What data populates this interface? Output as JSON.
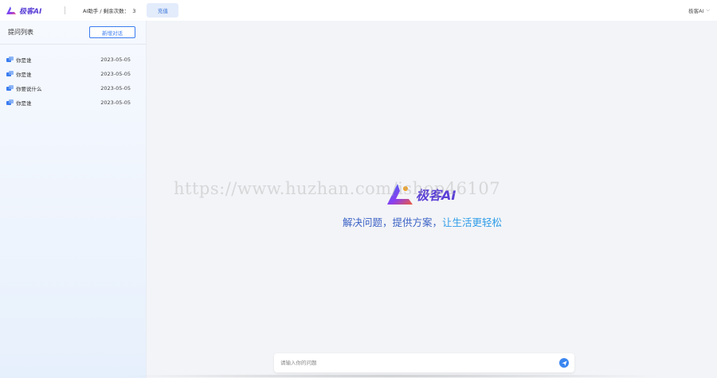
{
  "header": {
    "brand": "极客AI",
    "quota_label": "AI助手 / 剩余次数：",
    "quota_count": "3",
    "recharge_label": "充值",
    "user_label": "极客AI"
  },
  "sidebar": {
    "title": "提问列表",
    "new_chat_label": "新增对话",
    "items": [
      {
        "label": "你是谁",
        "date": "2023-05-05"
      },
      {
        "label": "你是谁",
        "date": "2023-05-05"
      },
      {
        "label": "你要说什么",
        "date": "2023-05-05"
      },
      {
        "label": "你是谁",
        "date": "2023-05-05"
      }
    ]
  },
  "main": {
    "brand": "极客AI",
    "slogan_part1": "解决问题，提供方案，",
    "slogan_part2": "让生活更轻松",
    "watermark": "https://www.huzhan.com/ishop46107"
  },
  "input": {
    "placeholder": "请输入你的问题"
  },
  "colors": {
    "brand": "#5b3fd6",
    "accent_blue": "#3a7cf0",
    "slogan": "#3d63c6"
  },
  "icons": {
    "logo": "triangle-logo-icon",
    "conversation": "chat-bubble-icon",
    "send": "send-plane-icon",
    "dropdown": "chevron-down-icon"
  }
}
